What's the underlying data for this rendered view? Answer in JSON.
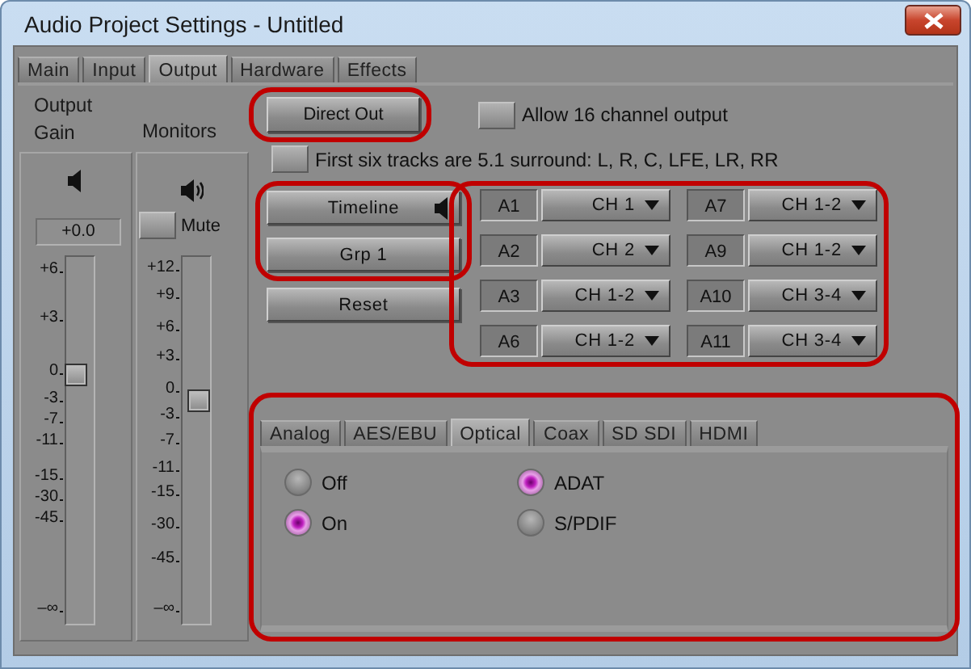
{
  "window": {
    "title": "Audio Project Settings - Untitled"
  },
  "tabs": [
    {
      "label": "Main",
      "selected": false
    },
    {
      "label": "Input",
      "selected": false
    },
    {
      "label": "Output",
      "selected": true
    },
    {
      "label": "Hardware",
      "selected": false
    },
    {
      "label": "Effects",
      "selected": false
    }
  ],
  "output_gain": {
    "title": "Output Gain",
    "value": "+0.0",
    "level": 0.68,
    "scale": [
      "+6",
      "+3",
      "0",
      "-3",
      "-7",
      "-11",
      "-15",
      "-30",
      "-45",
      "–∞"
    ]
  },
  "monitors": {
    "title": "Monitors",
    "mute": {
      "label": "Mute",
      "checked": false
    },
    "level": 0.61,
    "scale": [
      "+12",
      "+9",
      "+6",
      "+3",
      "0",
      "-3",
      "-7",
      "-11",
      "-15",
      "-30",
      "-45",
      "–∞"
    ]
  },
  "direct_out": {
    "label": "Direct Out",
    "highlighted": true
  },
  "options": [
    {
      "label": "Allow 16 channel output",
      "checked": false
    },
    {
      "label": "First six tracks are 5.1 surround: L, R, C, LFE, LR, RR",
      "checked": false
    }
  ],
  "routing": {
    "highlighted": true,
    "buttons": [
      {
        "label": "Timeline",
        "speaker": true
      },
      {
        "label": "Grp 1",
        "speaker": false
      }
    ]
  },
  "reset": {
    "label": "Reset"
  },
  "channels": {
    "highlighted": true,
    "items": [
      {
        "track": "A1",
        "output": "CH 1"
      },
      {
        "track": "A7",
        "output": "CH 1-2"
      },
      {
        "track": "A2",
        "output": "CH 2"
      },
      {
        "track": "A9",
        "output": "CH 1-2"
      },
      {
        "track": "A3",
        "output": "CH 1-2"
      },
      {
        "track": "A10",
        "output": "CH 3-4"
      },
      {
        "track": "A6",
        "output": "CH 1-2"
      },
      {
        "track": "A11",
        "output": "CH 3-4"
      }
    ]
  },
  "interface": {
    "highlighted": true,
    "tabs": [
      {
        "label": "Analog",
        "selected": false
      },
      {
        "label": "AES/EBU",
        "selected": false
      },
      {
        "label": "Optical",
        "selected": true
      },
      {
        "label": "Coax",
        "selected": false
      },
      {
        "label": "SD SDI",
        "selected": false
      },
      {
        "label": "HDMI",
        "selected": false
      }
    ],
    "groups": [
      [
        {
          "label": "Off",
          "selected": false
        },
        {
          "label": "On",
          "selected": true
        }
      ],
      [
        {
          "label": "ADAT",
          "selected": true
        },
        {
          "label": "S/PDIF",
          "selected": false
        }
      ]
    ]
  }
}
